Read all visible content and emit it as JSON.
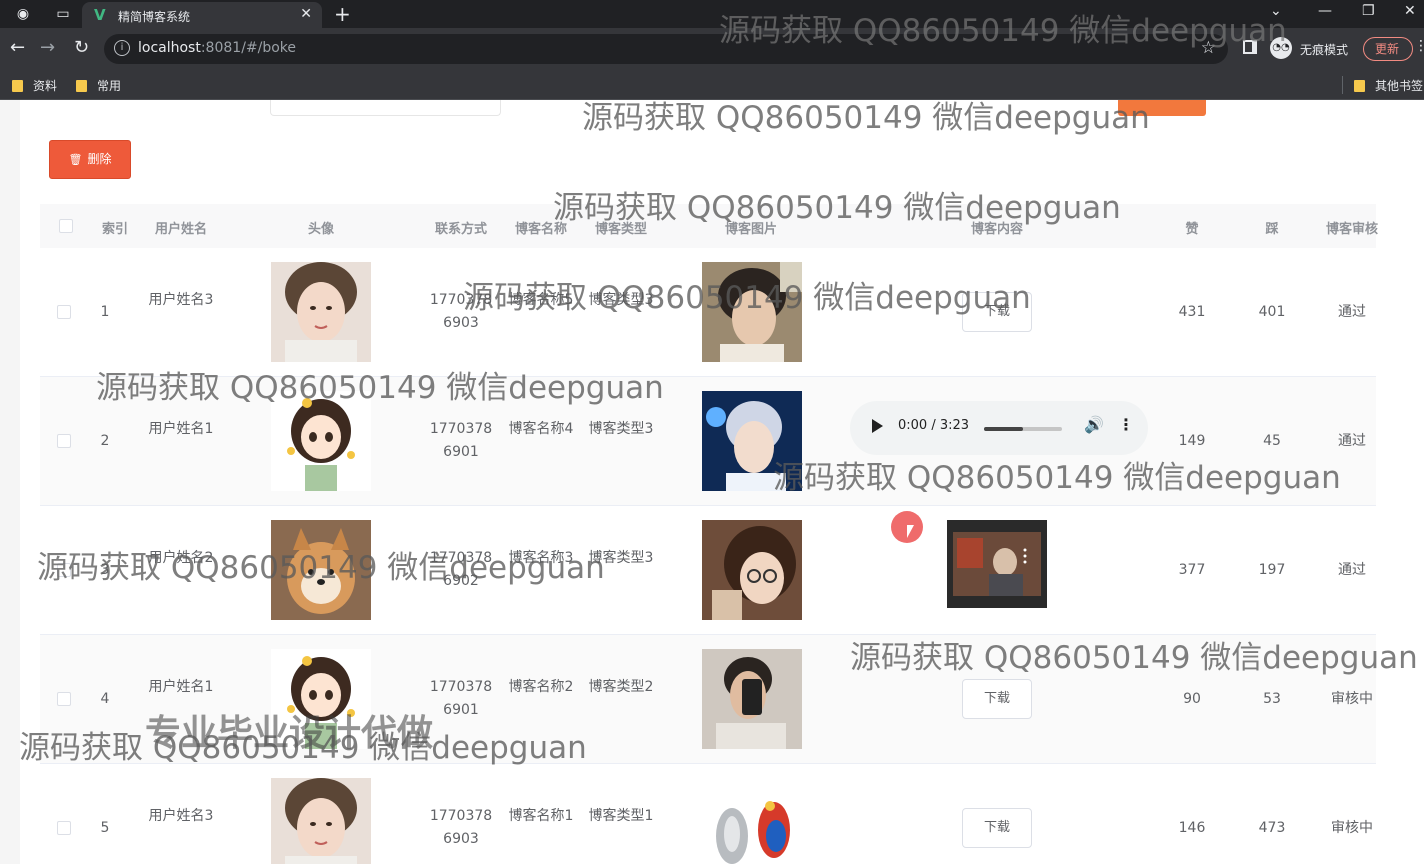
{
  "browser": {
    "tab_title": "精简博客系统",
    "url_host": "localhost",
    "url_rest": ":8081/#/boke",
    "incognito_label": "无痕模式",
    "update_label": "更新",
    "bookmarks": [
      "资料",
      "常用"
    ],
    "other_bookmarks": "其他书签"
  },
  "toolbar": {
    "delete_label": "删除"
  },
  "table": {
    "headers": {
      "index": "索引",
      "username": "用户姓名",
      "avatar": "头像",
      "contact": "联系方式",
      "blog_name": "博客名称",
      "blog_type": "博客类型",
      "blog_image": "博客图片",
      "blog_content": "博客内容",
      "likes": "赞",
      "dislikes": "踩",
      "review": "博客审核"
    },
    "download_label": "下载",
    "rows": [
      {
        "index": "1",
        "username": "用户姓名3",
        "contact": "17703786903",
        "blog_name": "博客名称5",
        "blog_type": "博客类型3",
        "content": "download",
        "likes": "431",
        "dislikes": "401",
        "review": "通过"
      },
      {
        "index": "2",
        "username": "用户姓名1",
        "contact": "17703786901",
        "blog_name": "博客名称4",
        "blog_type": "博客类型3",
        "content": "audio",
        "likes": "149",
        "dislikes": "45",
        "review": "通过"
      },
      {
        "index": "3",
        "username": "用户姓名2",
        "contact": "17703786902",
        "blog_name": "博客名称3",
        "blog_type": "博客类型3",
        "content": "video",
        "likes": "377",
        "dislikes": "197",
        "review": "通过"
      },
      {
        "index": "4",
        "username": "用户姓名1",
        "contact": "17703786901",
        "blog_name": "博客名称2",
        "blog_type": "博客类型2",
        "content": "download",
        "likes": "90",
        "dislikes": "53",
        "review": "审核中"
      },
      {
        "index": "5",
        "username": "用户姓名3",
        "contact": "17703786903",
        "blog_name": "博客名称1",
        "blog_type": "博客类型1",
        "content": "download",
        "likes": "146",
        "dislikes": "473",
        "review": "审核中"
      }
    ]
  },
  "audio_player": {
    "time": "0:00 / 3:23",
    "progress": 0.5
  },
  "watermarks": {
    "text": "源码获取 QQ86050149 微信deepguan",
    "overlay": "专业毕业设计代做"
  }
}
